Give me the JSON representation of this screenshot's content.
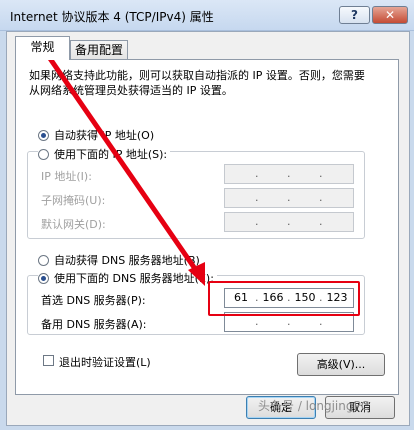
{
  "window": {
    "title": "Internet 协议版本 4 (TCP/IPv4) 属性",
    "help_label": "?",
    "close_label": "✕"
  },
  "tabs": [
    {
      "label": "常规"
    },
    {
      "label": "备用配置"
    }
  ],
  "description": "如果网络支持此功能，则可以获取自动指派的 IP 设置。否则，您需要从网络系统管理员处获得适当的 IP 设置。",
  "ip_section": {
    "auto_label": "自动获得 IP 地址(O)",
    "manual_label": "使用下面的 IP 地址(S):",
    "fields": [
      {
        "label": "IP 地址(I):"
      },
      {
        "label": "子网掩码(U):"
      },
      {
        "label": "默认网关(D):"
      }
    ]
  },
  "dns_section": {
    "auto_label": "自动获得 DNS 服务器地址(B)",
    "manual_label": "使用下面的 DNS 服务器地址(E):",
    "preferred_label": "首选 DNS 服务器(P):",
    "preferred_value": [
      "61",
      "166",
      "150",
      "123"
    ],
    "alternate_label": "备用 DNS 服务器(A):"
  },
  "validate_label": "退出时验证设置(L)",
  "advanced_label": "高级(V)...",
  "ok_label": "确定",
  "cancel_label": "取消",
  "watermark": "头条号 / longjingPC",
  "colors": {
    "annotation": "#e60012",
    "selected_radio": "#2a4f8f"
  }
}
